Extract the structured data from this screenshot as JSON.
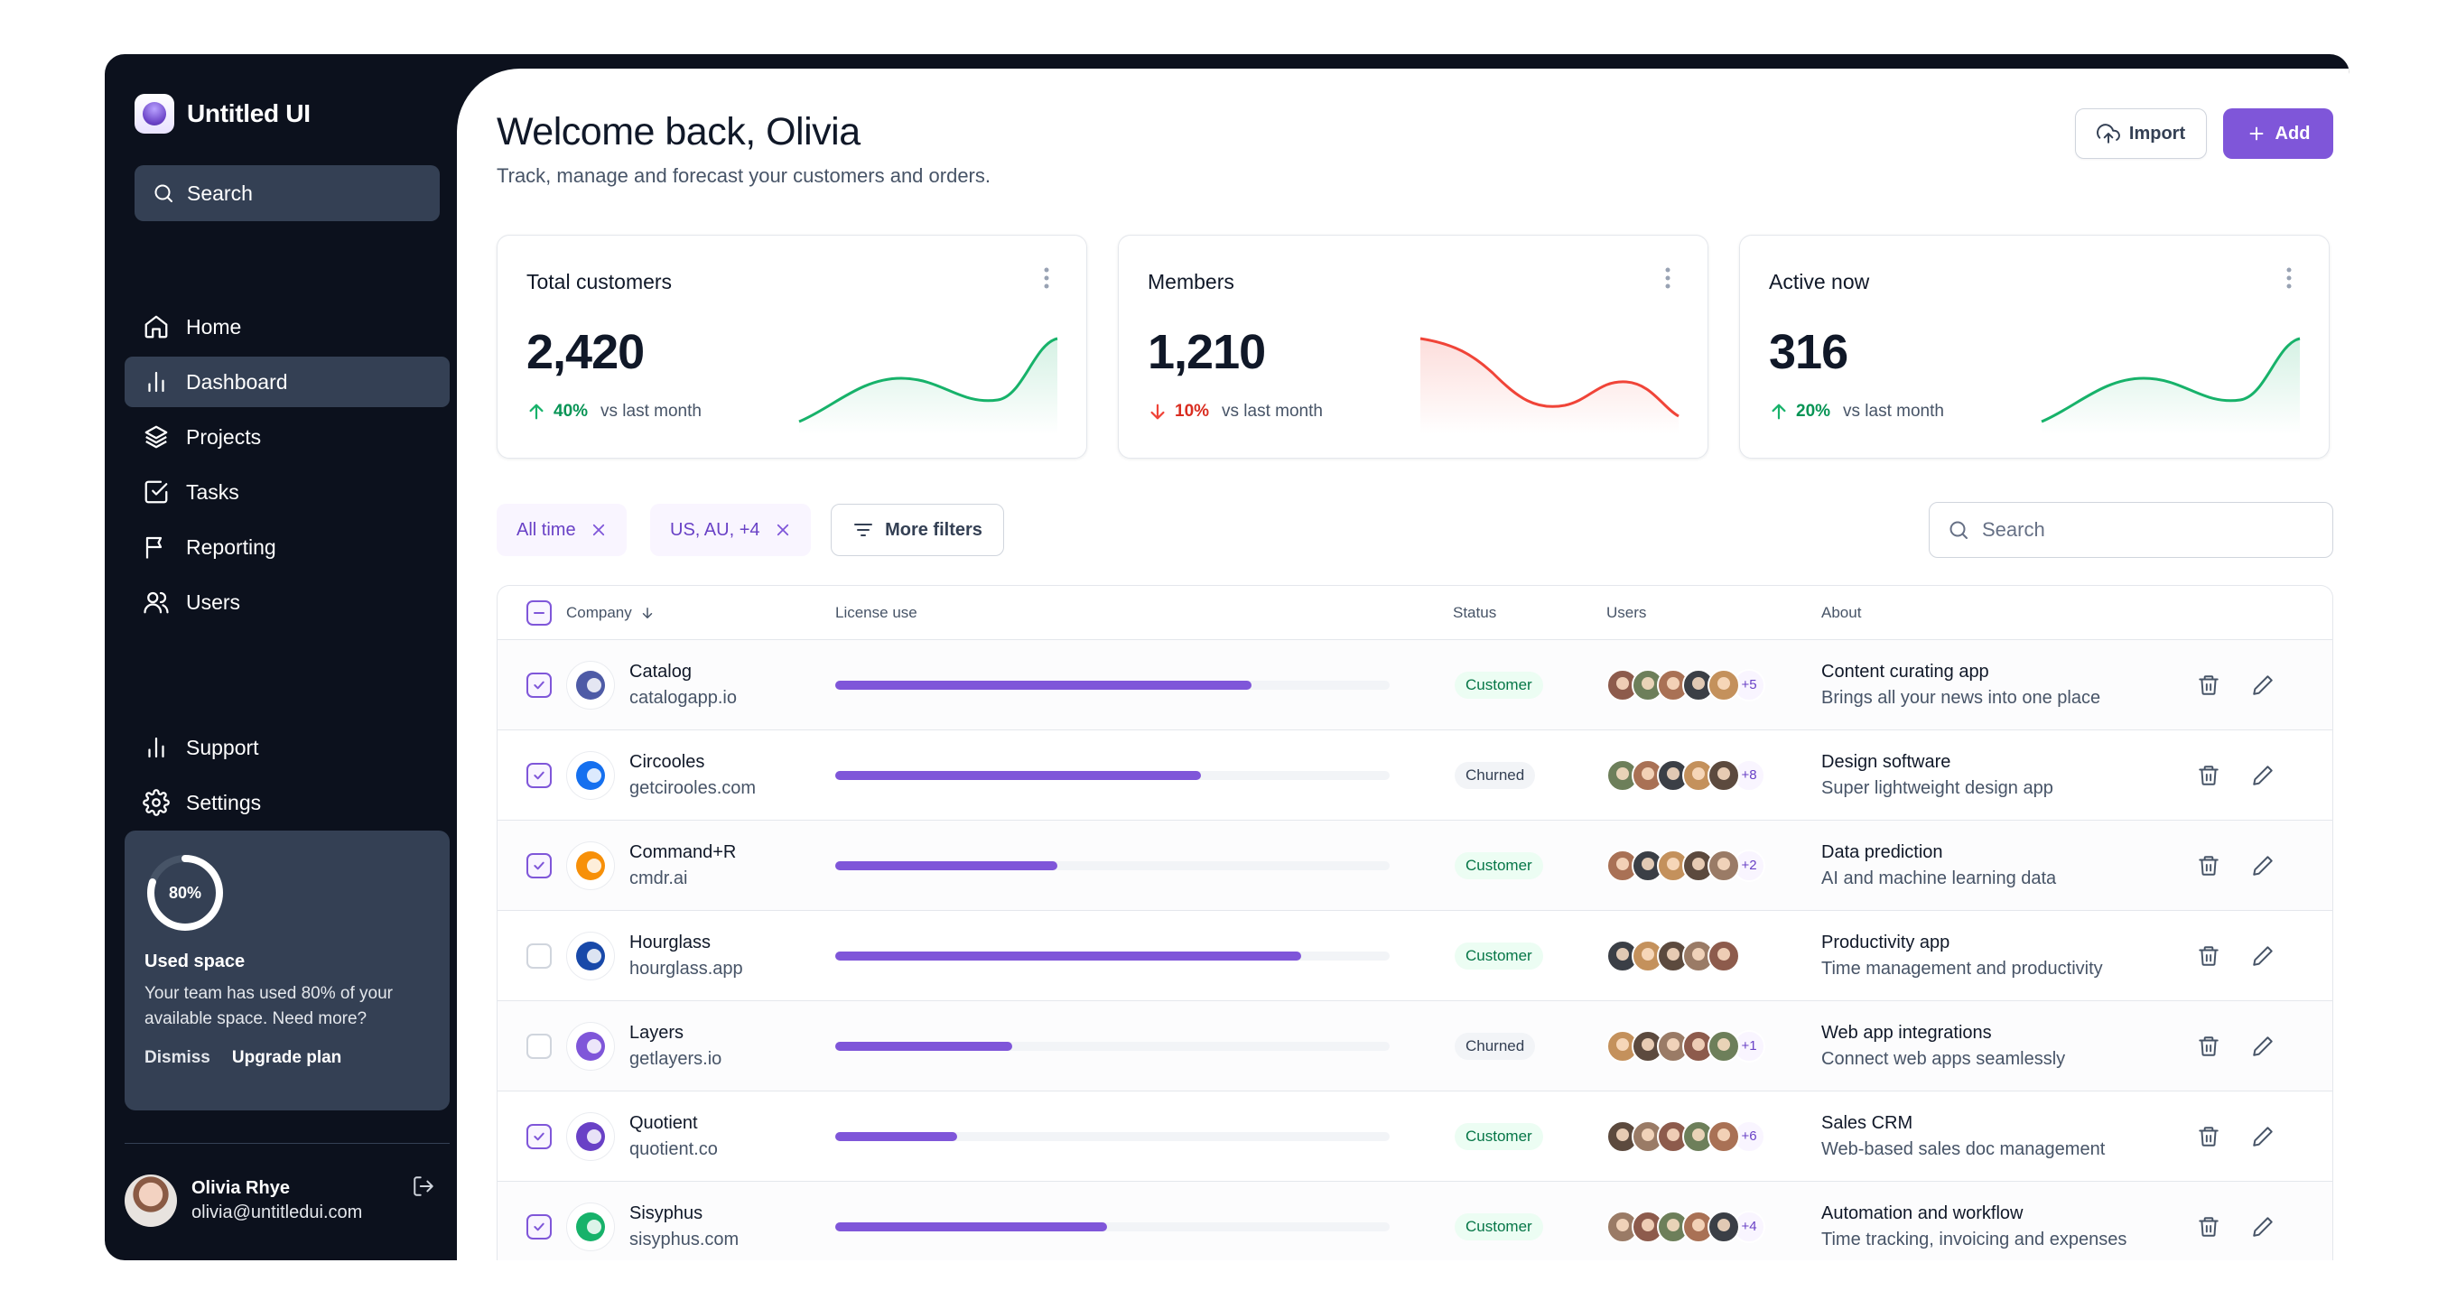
{
  "brand": {
    "name": "Untitled UI"
  },
  "sidebar": {
    "search_placeholder": "Search",
    "nav": [
      {
        "label": "Home",
        "icon": "home-icon"
      },
      {
        "label": "Dashboard",
        "icon": "bar-chart-icon",
        "active": true
      },
      {
        "label": "Projects",
        "icon": "layers-icon"
      },
      {
        "label": "Tasks",
        "icon": "check-square-icon"
      },
      {
        "label": "Reporting",
        "icon": "flag-icon"
      },
      {
        "label": "Users",
        "icon": "users-icon"
      }
    ],
    "nav_bottom": [
      {
        "label": "Support",
        "icon": "bar-chart-icon"
      },
      {
        "label": "Settings",
        "icon": "gear-icon"
      }
    ],
    "usage": {
      "percent_label": "80%",
      "percent_value": 0.8,
      "title": "Used space",
      "description": "Your team has used 80% of your available space. Need more?",
      "dismiss": "Dismiss",
      "upgrade": "Upgrade plan"
    },
    "user": {
      "name": "Olivia Rhye",
      "email": "olivia@untitledui.com"
    }
  },
  "header": {
    "title": "Welcome back, Olivia",
    "subtitle": "Track, manage and forecast your customers and orders.",
    "import_label": "Import",
    "add_label": "Add"
  },
  "stats": [
    {
      "label": "Total customers",
      "value": "2,420",
      "delta": "40%",
      "direction": "up",
      "vs": "vs last month",
      "color": "#17b26a"
    },
    {
      "label": "Members",
      "value": "1,210",
      "delta": "10%",
      "direction": "down",
      "vs": "vs last month",
      "color": "#f04438"
    },
    {
      "label": "Active now",
      "value": "316",
      "delta": "20%",
      "direction": "up",
      "vs": "vs last month",
      "color": "#17b26a"
    }
  ],
  "filters": {
    "chip_time": "All time",
    "chip_region": "US, AU, +4",
    "more": "More filters",
    "search_placeholder": "Search"
  },
  "table": {
    "headers": {
      "company": "Company",
      "license": "License use",
      "status": "Status",
      "users": "Users",
      "about": "About"
    },
    "rows": [
      {
        "checked": true,
        "name": "Catalog",
        "domain": "catalogapp.io",
        "license": 0.75,
        "status": "Customer",
        "avatars": 5,
        "more": "+5",
        "about_title": "Content curating app",
        "about_sub": "Brings all your news into one place",
        "logo": "#4e5ba6"
      },
      {
        "checked": true,
        "name": "Circooles",
        "domain": "getcirooles.com",
        "license": 0.66,
        "status": "Churned",
        "avatars": 5,
        "more": "+8",
        "about_title": "Design software",
        "about_sub": "Super lightweight design app",
        "logo": "#1570ef"
      },
      {
        "checked": true,
        "name": "Command+R",
        "domain": "cmdr.ai",
        "license": 0.4,
        "status": "Customer",
        "avatars": 5,
        "more": "+2",
        "about_title": "Data prediction",
        "about_sub": "AI and machine learning data",
        "logo": "#f79009"
      },
      {
        "checked": false,
        "name": "Hourglass",
        "domain": "hourglass.app",
        "license": 0.84,
        "status": "Customer",
        "avatars": 5,
        "more": "",
        "about_title": "Productivity app",
        "about_sub": "Time management and productivity",
        "logo": "#1849a9"
      },
      {
        "checked": false,
        "name": "Layers",
        "domain": "getlayers.io",
        "license": 0.32,
        "status": "Churned",
        "avatars": 5,
        "more": "+1",
        "about_title": "Web app integrations",
        "about_sub": "Connect web apps seamlessly",
        "logo": "#7f56d9"
      },
      {
        "checked": true,
        "name": "Quotient",
        "domain": "quotient.co",
        "license": 0.22,
        "status": "Customer",
        "avatars": 5,
        "more": "+6",
        "about_title": "Sales CRM",
        "about_sub": "Web-based sales doc management",
        "logo": "#6941c6"
      },
      {
        "checked": true,
        "name": "Sisyphus",
        "domain": "sisyphus.com",
        "license": 0.49,
        "status": "Customer",
        "avatars": 5,
        "more": "+4",
        "about_title": "Automation and workflow",
        "about_sub": "Time tracking, invoicing and expenses",
        "logo": "#17b26a"
      }
    ]
  }
}
